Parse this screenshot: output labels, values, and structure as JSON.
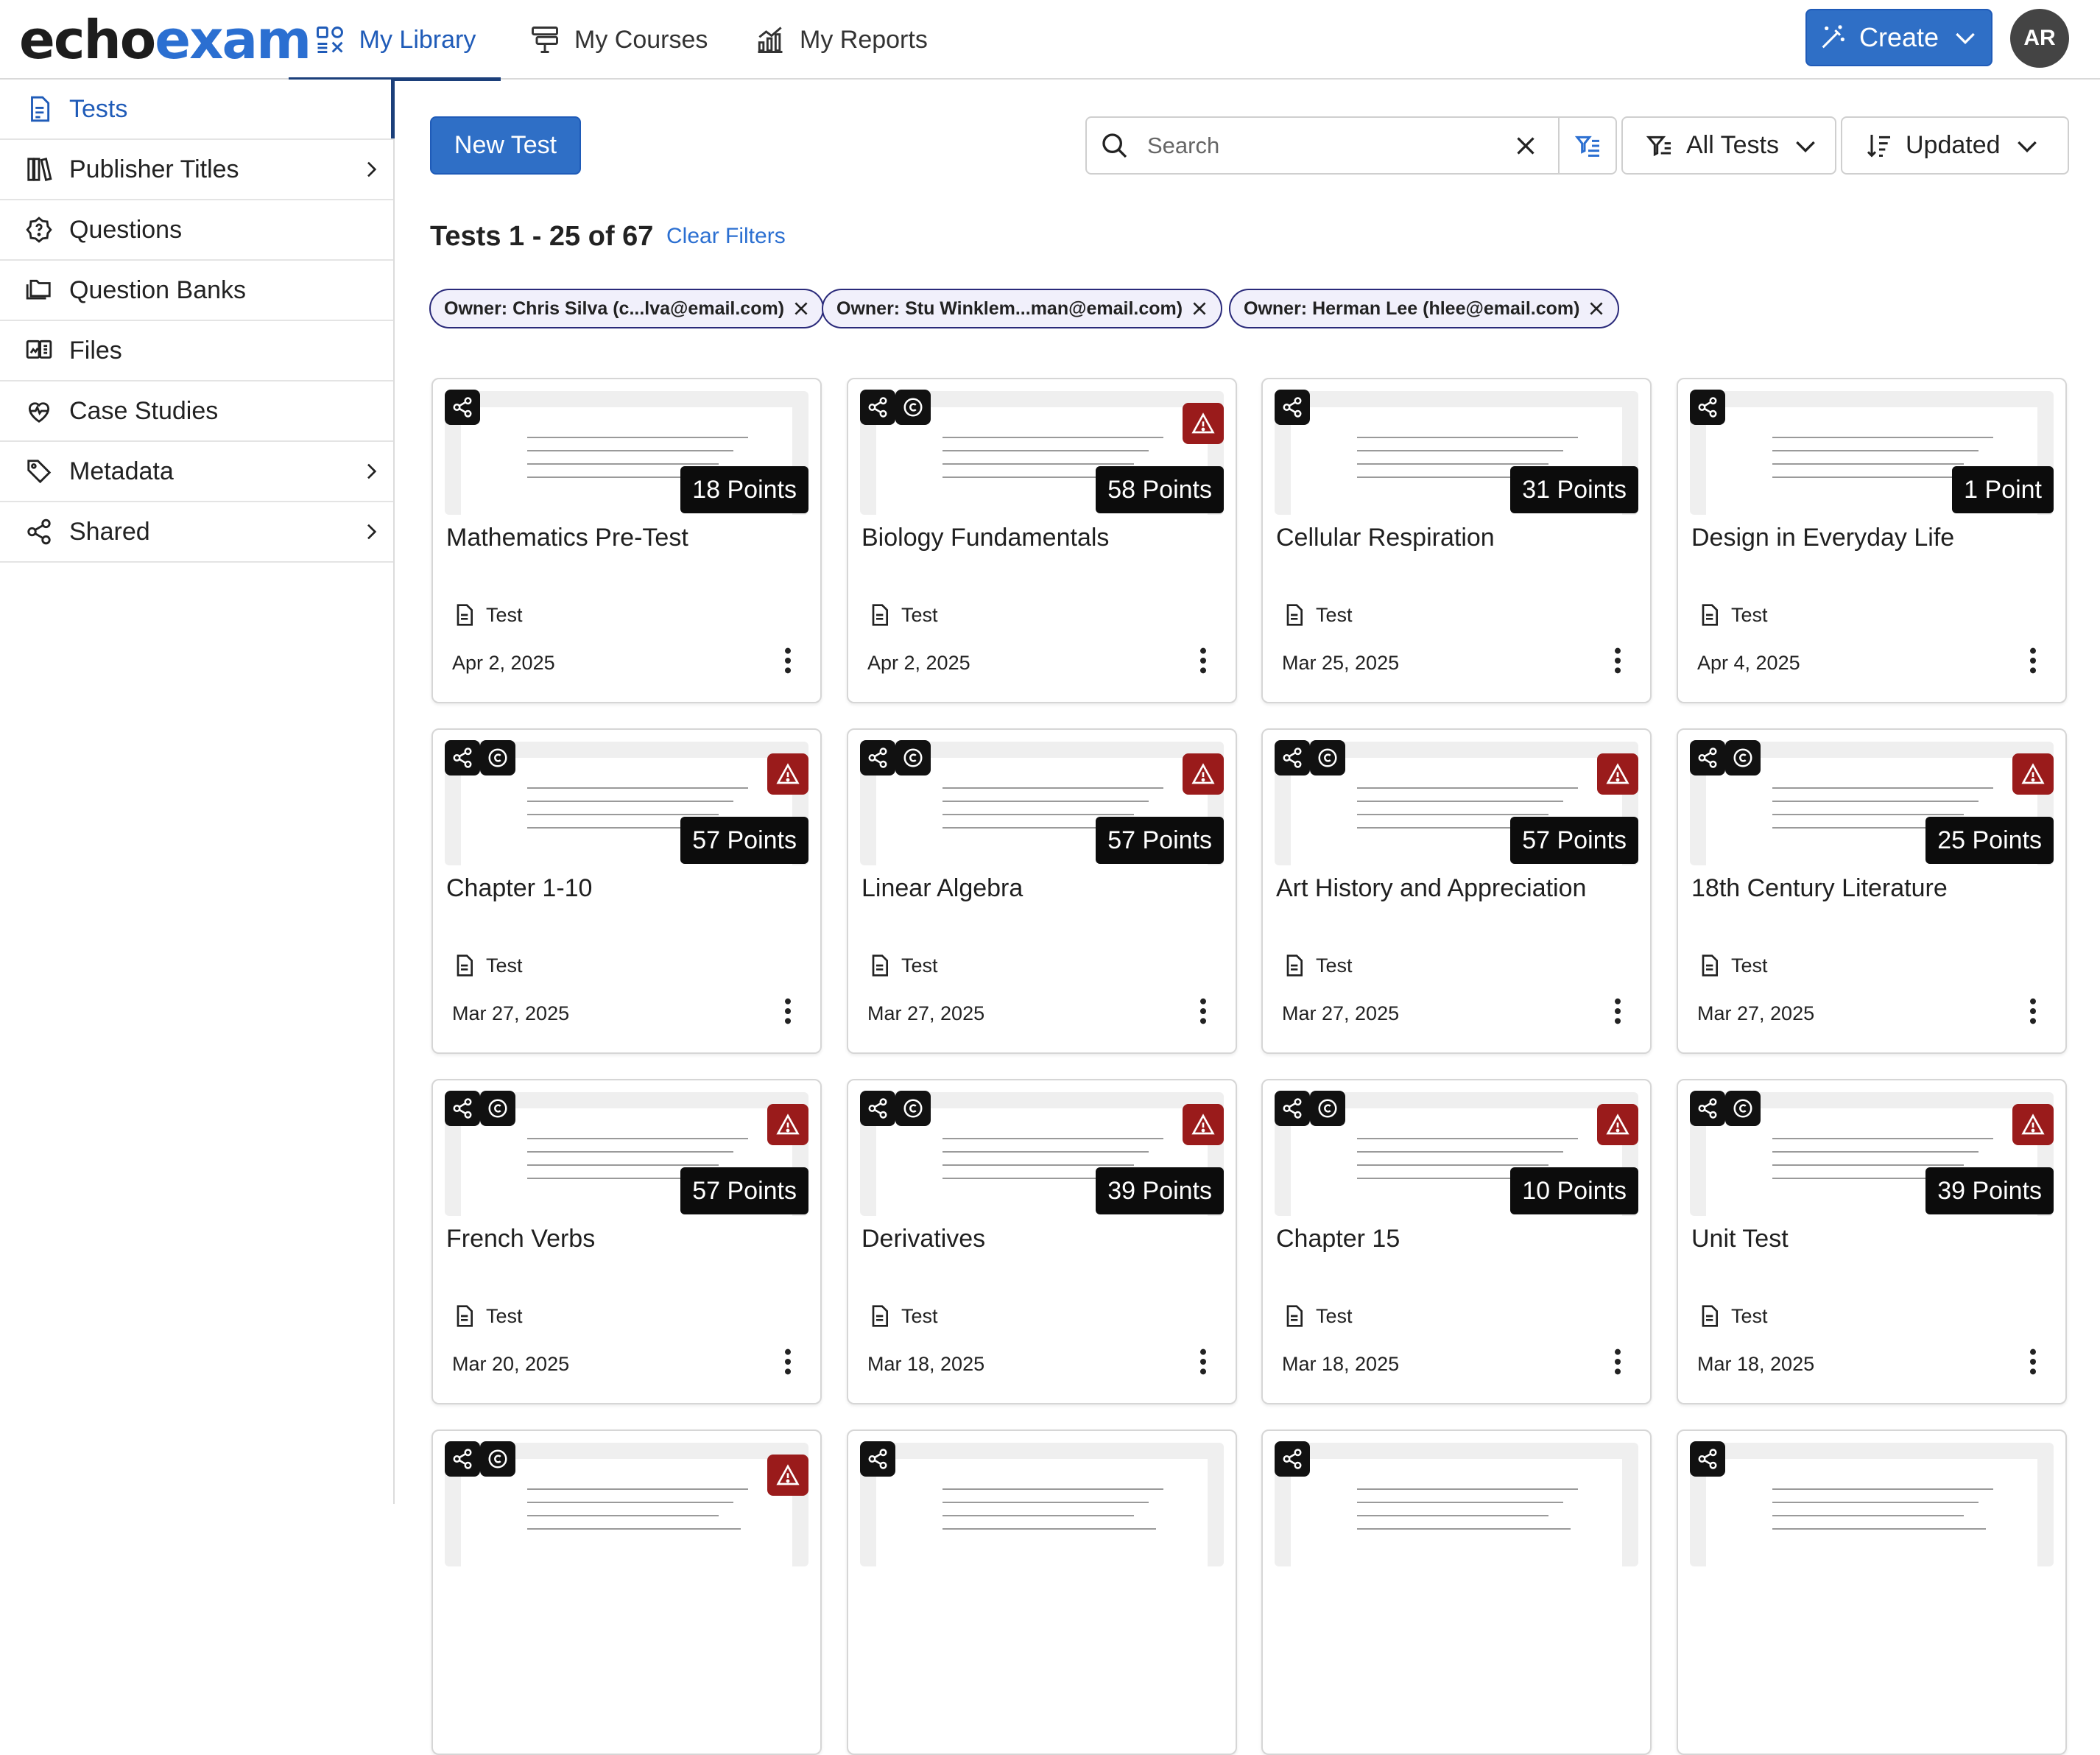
{
  "app": {
    "logo_part1": "echo",
    "logo_part2": "exam",
    "avatar_initials": "AR",
    "create_label": "Create",
    "accent_color": "#2f6fc6"
  },
  "nav": {
    "tabs": [
      {
        "label": "My Library",
        "active": true
      },
      {
        "label": "My Courses"
      },
      {
        "label": "My Reports"
      }
    ]
  },
  "sidebar": {
    "items": [
      {
        "label": "Tests",
        "active": true
      },
      {
        "label": "Publisher Titles",
        "has_chevron": true
      },
      {
        "label": "Questions"
      },
      {
        "label": "Question Banks"
      },
      {
        "label": "Files"
      },
      {
        "label": "Case Studies"
      },
      {
        "label": "Metadata",
        "has_chevron": true
      },
      {
        "label": "Shared",
        "has_chevron": true
      }
    ]
  },
  "toolbar": {
    "new_test_label": "New Test",
    "search_placeholder": "Search",
    "filter_label": "All Tests",
    "sort_label": "Updated"
  },
  "results": {
    "count_text": "Tests 1 - 25 of 67",
    "clear_filters_label": "Clear Filters"
  },
  "filters": [
    "Owner: Chris Silva (c...lva@email.com)",
    "Owner: Stu Winklem...man@email.com)",
    "Owner: Herman Lee (hlee@email.com)"
  ],
  "cards": [
    {
      "title": "Mathematics Pre-Test",
      "points": "18 Points",
      "type": "Test",
      "date": "Apr 2, 2025",
      "copyright": false,
      "warning": false,
      "preview": "this is the question"
    },
    {
      "title": "Biology Fundamentals",
      "points": "58 Points",
      "type": "Test",
      "date": "Apr 2, 2025",
      "copyright": true,
      "warning": true,
      "preview": "this is the question"
    },
    {
      "title": "Cellular Respiration",
      "points": "31 Points",
      "type": "Test",
      "date": "Mar 25, 2025",
      "copyright": false,
      "warning": false,
      "preview": "Radioactive tracers can be used to help"
    },
    {
      "title": "Design in Everyday Life",
      "points": "1 Point",
      "type": "Test",
      "date": "Apr 4, 2025",
      "copyright": false,
      "warning": false,
      "preview": "Who is the best EchoExam customer?"
    },
    {
      "title": "Chapter 1-10",
      "points": "57 Points",
      "type": "Test",
      "date": "Mar 27, 2025",
      "copyright": true,
      "warning": true,
      "preview": "Match each cooking method with its appropriate description and common food item."
    },
    {
      "title": "Linear Algebra",
      "points": "57 Points",
      "type": "Test",
      "date": "Mar 27, 2025",
      "copyright": true,
      "warning": true,
      "preview": "Match each cooking method with its appropriate description and common food item."
    },
    {
      "title": "Art History and Appreciation",
      "points": "57 Points",
      "type": "Test",
      "date": "Mar 27, 2025",
      "copyright": true,
      "warning": true,
      "preview": "Match each cooking method with its appropriate description and common food item."
    },
    {
      "title": "18th Century Literature",
      "points": "25 Points",
      "type": "Test",
      "date": "Mar 27, 2025",
      "copyright": true,
      "warning": true,
      "preview": "Explain the difference between a square and a rectangle."
    },
    {
      "title": "French Verbs",
      "points": "57 Points",
      "type": "Test",
      "date": "Mar 20, 2025",
      "copyright": true,
      "warning": true,
      "preview": "Discuss the impact of using various spices in cooking on flavor development and overall dish quality."
    },
    {
      "title": "Derivatives",
      "points": "39 Points",
      "type": "Test",
      "date": "Mar 18, 2025",
      "copyright": true,
      "warning": true,
      "preview": "Which of the following is the summation for the series"
    },
    {
      "title": "Chapter 15",
      "points": "10 Points",
      "type": "Test",
      "date": "Mar 18, 2025",
      "copyright": true,
      "warning": true,
      "preview": "Which of the following is the summation for the series"
    },
    {
      "title": "Unit Test",
      "points": "39 Points",
      "type": "Test",
      "date": "Mar 18, 2025",
      "copyright": true,
      "warning": true,
      "preview": "Which of the following is the summation for the series"
    },
    {
      "title": "",
      "points": "",
      "type": "",
      "date": "",
      "copyright": true,
      "warning": true,
      "preview": "Question Bowtie - test"
    },
    {
      "title": "",
      "points": "",
      "type": "",
      "date": "",
      "copyright": false,
      "warning": false,
      "preview": "Question Bowtie - test"
    },
    {
      "title": "",
      "points": "",
      "type": "",
      "date": "",
      "copyright": false,
      "warning": false,
      "preview": "Bimodal"
    },
    {
      "title": "",
      "points": "",
      "type": "",
      "date": "",
      "copyright": false,
      "warning": false,
      "preview": "Bowtie Question"
    }
  ]
}
